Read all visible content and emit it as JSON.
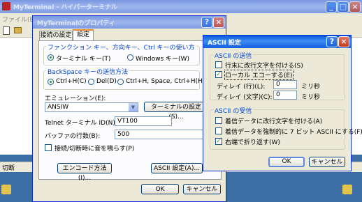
{
  "colors": {
    "desktop": "#3a6ea5",
    "title_active": "#0a5bdc",
    "group_title": "#0046d5",
    "check": "#21a121"
  },
  "background_window": {
    "title": "MyTerminal - ハイパーターミナル",
    "menu_first": "ファイル(E)",
    "status_text": "切断"
  },
  "properties_dialog": {
    "title": "MyTerminalのプロパティ",
    "tabs": [
      "接続の設定",
      "設定"
    ],
    "function_keys": {
      "group_title": "ファンクション キー、方向キー、Ctrl キーの使い方",
      "options": [
        "ターミナル キー(T)",
        "Windows キー(W)"
      ],
      "selected": 0
    },
    "backspace": {
      "group_title": "BackSpace キーの送信方法",
      "options": [
        "Ctrl+H(C)",
        "Del(D)",
        "Ctrl+H, Space, Ctrl+H(H)"
      ],
      "selected": 0
    },
    "emulation": {
      "label": "エミュレーション(E):",
      "value": "ANSIW",
      "setup_button": "ターミナルの設定(S)..."
    },
    "telnet": {
      "label": "Telnet ターミナル ID(N):",
      "value": "VT100"
    },
    "buffer": {
      "label": "バッファの行数(B):",
      "value": "500"
    },
    "beep": {
      "label": "接続/切断時に音を鳴らす(P)",
      "checked": false
    },
    "encode_button": "エンコード方法(I)...",
    "ascii_button": "ASCII 設定(A)...",
    "ok": "OK",
    "cancel": "キャンセル"
  },
  "ascii_dialog": {
    "title": "ASCII 設定",
    "send": {
      "group_title": "ASCII の送信",
      "line_ends": {
        "label": "行末に改行文字を付ける(S)",
        "checked": false
      },
      "local_echo": {
        "label": "ローカル エコーする(E)",
        "checked": true
      },
      "line_delay": {
        "label": "ディレイ (行)(L):",
        "value": "0",
        "unit": "ミリ秒"
      },
      "char_delay": {
        "label": "ディレイ (文字)(C):",
        "value": "0",
        "unit": "ミリ秒"
      }
    },
    "receive": {
      "group_title": "ASCII の受信",
      "append_lf": {
        "label": "着信データに改行文字を付ける(A)",
        "checked": false
      },
      "force_7bit": {
        "label": "着信データを強制的に 7 ビット ASCII にする(F)",
        "checked": false
      },
      "wrap": {
        "label": "右端で折り返す(W)",
        "checked": true
      }
    },
    "ok": "OK",
    "cancel": "キャンセル"
  }
}
